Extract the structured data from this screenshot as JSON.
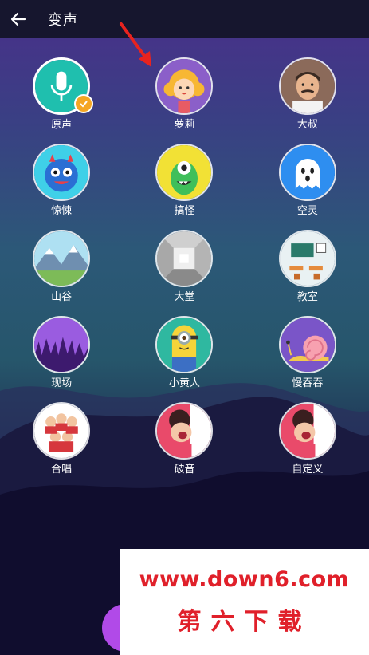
{
  "header": {
    "title": "变声"
  },
  "voices": [
    {
      "label": "原声",
      "icon": "microphone-icon",
      "selected": true
    },
    {
      "label": "萝莉",
      "icon": "loli-girl-icon"
    },
    {
      "label": "大叔",
      "icon": "uncle-man-icon"
    },
    {
      "label": "惊悚",
      "icon": "fuzzy-monster-icon"
    },
    {
      "label": "搞怪",
      "icon": "green-monster-icon"
    },
    {
      "label": "空灵",
      "icon": "ghost-icon"
    },
    {
      "label": "山谷",
      "icon": "mountain-valley-icon"
    },
    {
      "label": "大堂",
      "icon": "hall-room-icon"
    },
    {
      "label": "教室",
      "icon": "classroom-icon"
    },
    {
      "label": "现场",
      "icon": "concert-crowd-icon"
    },
    {
      "label": "小黄人",
      "icon": "minion-icon"
    },
    {
      "label": "慢吞吞",
      "icon": "snail-icon"
    },
    {
      "label": "合唱",
      "icon": "choir-icon"
    },
    {
      "label": "破音",
      "icon": "screaming-man-icon"
    },
    {
      "label": "自定义",
      "icon": "custom-voice-icon"
    }
  ],
  "watermark": {
    "url": "www.down6.com",
    "name": "第六下载"
  },
  "colors": {
    "accent": "#f5a623",
    "header_bg": "#16162e",
    "watermark_text": "#e0202a"
  }
}
